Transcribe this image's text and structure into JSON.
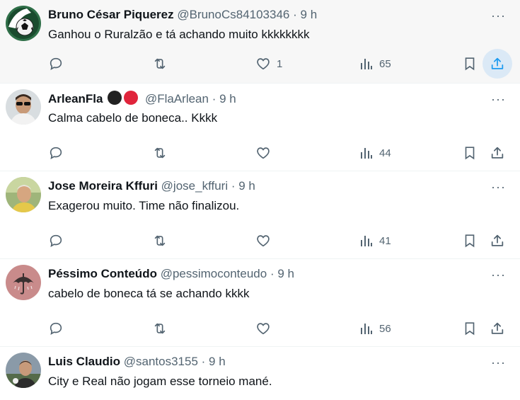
{
  "tweets": [
    {
      "name": "Bruno César Piquerez",
      "handle": "@BrunoCs84103346",
      "sep": "·",
      "time": "9 h",
      "text": "Ganhou o Ruralzão e tá achando muito kkkkkkkk",
      "likes": "1",
      "views": "65",
      "avatar_icon": "soccer-ball-avatar"
    },
    {
      "name": "ArleanFla",
      "handle": "@FlaArlean",
      "sep": "·",
      "time": "9 h",
      "text": "Calma cabelo de boneca.. Kkkk",
      "likes": "",
      "views": "44",
      "avatar_icon": "person-sunglasses-avatar",
      "badge_colors": [
        "#222222",
        "#e0243b"
      ]
    },
    {
      "name": "Jose Moreira Kffuri",
      "handle": "@jose_kffuri",
      "sep": "·",
      "time": "9 h",
      "text": "Exagerou muito. Time não finalizou.",
      "likes": "",
      "views": "41",
      "avatar_icon": "person-avatar"
    },
    {
      "name": "Péssimo Conteúdo",
      "handle": "@pessimoconteudo",
      "sep": "·",
      "time": "9 h",
      "text": "cabelo de boneca tá se achando kkkk",
      "likes": "",
      "views": "56",
      "avatar_icon": "umbrella-avatar"
    },
    {
      "name": "Luis Claudio",
      "handle": "@santos3155",
      "sep": "·",
      "time": "9 h",
      "text": "City e Real não jogam esse torneio mané.",
      "avatar_icon": "person-outdoor-avatar"
    }
  ],
  "more_label": "···",
  "colors": {
    "text": "#0f1419",
    "muted": "#536471",
    "accent": "#1d9bf0",
    "hover": "#f7f7f7"
  }
}
